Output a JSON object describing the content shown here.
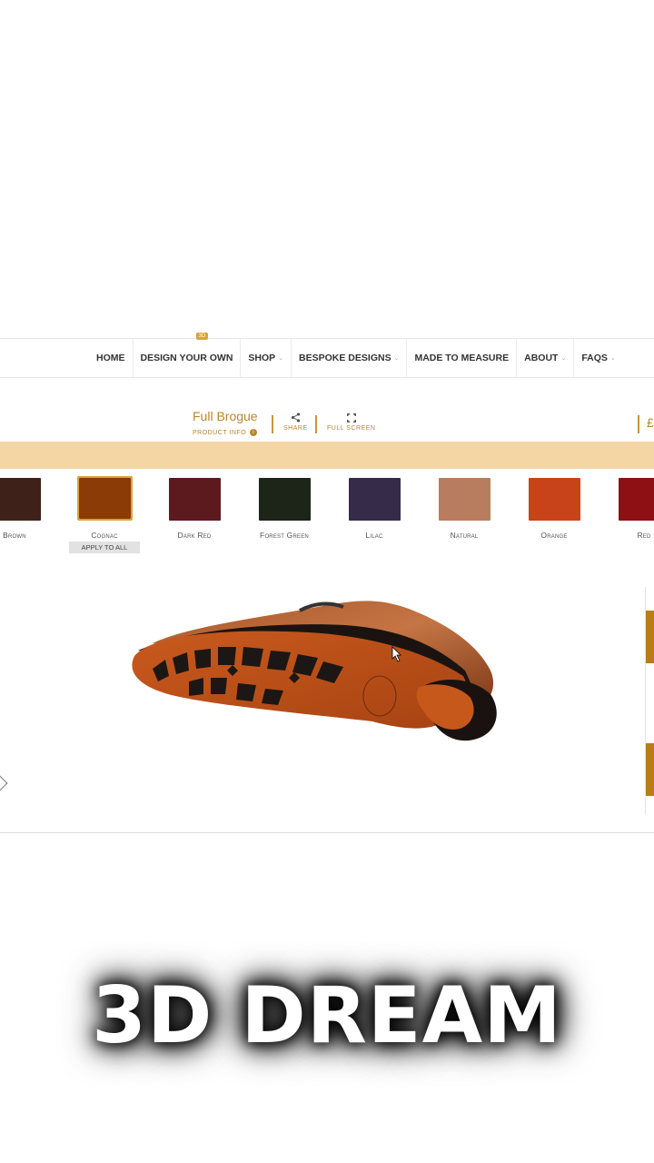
{
  "nav": {
    "items": [
      {
        "label": "HOME",
        "dropdown": false
      },
      {
        "label": "DESIGN YOUR OWN",
        "dropdown": false,
        "badge": "3D"
      },
      {
        "label": "SHOP",
        "dropdown": true
      },
      {
        "label": "BESPOKE DESIGNS",
        "dropdown": true
      },
      {
        "label": "MADE TO MEASURE",
        "dropdown": false
      },
      {
        "label": "ABOUT",
        "dropdown": true
      },
      {
        "label": "FAQS",
        "dropdown": true
      }
    ]
  },
  "product": {
    "title": "Full Brogue",
    "info_label": "PRODUCT INFO",
    "share_label": "SHARE",
    "fullscreen_label": "FULL SCREEN",
    "price_prefix": "£"
  },
  "swatches": [
    {
      "name": "Brown",
      "color": "#3e2118"
    },
    {
      "name": "Cognac",
      "color": "#8a3b06",
      "selected": true
    },
    {
      "name": "Dark Red",
      "color": "#5c1a1e"
    },
    {
      "name": "Forest Green",
      "color": "#1c2517"
    },
    {
      "name": "Lilac",
      "color": "#372b4a"
    },
    {
      "name": "Natural",
      "color": "#b87d5f"
    },
    {
      "name": "Orange",
      "color": "#c9431a"
    },
    {
      "name": "Red",
      "color": "#8f1014"
    }
  ],
  "apply_all_label": "APPLY TO ALL",
  "caption": "3D DREAM",
  "colors": {
    "accent": "#b8862e",
    "band": "#f3d6a4",
    "badge": "#d9a33c"
  }
}
